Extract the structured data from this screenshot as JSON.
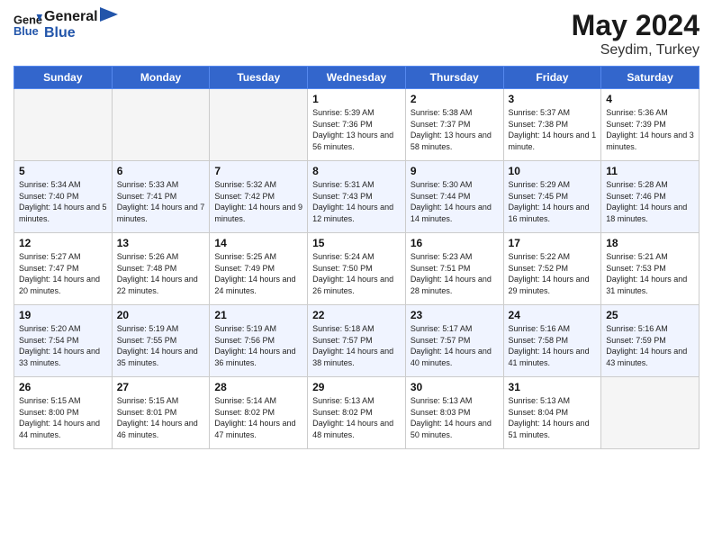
{
  "header": {
    "logo_line1": "General",
    "logo_line2": "Blue",
    "month_year": "May 2024",
    "location": "Seydim, Turkey"
  },
  "days_of_week": [
    "Sunday",
    "Monday",
    "Tuesday",
    "Wednesday",
    "Thursday",
    "Friday",
    "Saturday"
  ],
  "weeks": [
    [
      {
        "empty": true
      },
      {
        "empty": true
      },
      {
        "empty": true
      },
      {
        "day": "1",
        "sunrise": "5:39 AM",
        "sunset": "7:36 PM",
        "daylight": "13 hours and 56 minutes."
      },
      {
        "day": "2",
        "sunrise": "5:38 AM",
        "sunset": "7:37 PM",
        "daylight": "13 hours and 58 minutes."
      },
      {
        "day": "3",
        "sunrise": "5:37 AM",
        "sunset": "7:38 PM",
        "daylight": "14 hours and 1 minute."
      },
      {
        "day": "4",
        "sunrise": "5:36 AM",
        "sunset": "7:39 PM",
        "daylight": "14 hours and 3 minutes."
      }
    ],
    [
      {
        "day": "5",
        "sunrise": "5:34 AM",
        "sunset": "7:40 PM",
        "daylight": "14 hours and 5 minutes."
      },
      {
        "day": "6",
        "sunrise": "5:33 AM",
        "sunset": "7:41 PM",
        "daylight": "14 hours and 7 minutes."
      },
      {
        "day": "7",
        "sunrise": "5:32 AM",
        "sunset": "7:42 PM",
        "daylight": "14 hours and 9 minutes."
      },
      {
        "day": "8",
        "sunrise": "5:31 AM",
        "sunset": "7:43 PM",
        "daylight": "14 hours and 12 minutes."
      },
      {
        "day": "9",
        "sunrise": "5:30 AM",
        "sunset": "7:44 PM",
        "daylight": "14 hours and 14 minutes."
      },
      {
        "day": "10",
        "sunrise": "5:29 AM",
        "sunset": "7:45 PM",
        "daylight": "14 hours and 16 minutes."
      },
      {
        "day": "11",
        "sunrise": "5:28 AM",
        "sunset": "7:46 PM",
        "daylight": "14 hours and 18 minutes."
      }
    ],
    [
      {
        "day": "12",
        "sunrise": "5:27 AM",
        "sunset": "7:47 PM",
        "daylight": "14 hours and 20 minutes."
      },
      {
        "day": "13",
        "sunrise": "5:26 AM",
        "sunset": "7:48 PM",
        "daylight": "14 hours and 22 minutes."
      },
      {
        "day": "14",
        "sunrise": "5:25 AM",
        "sunset": "7:49 PM",
        "daylight": "14 hours and 24 minutes."
      },
      {
        "day": "15",
        "sunrise": "5:24 AM",
        "sunset": "7:50 PM",
        "daylight": "14 hours and 26 minutes."
      },
      {
        "day": "16",
        "sunrise": "5:23 AM",
        "sunset": "7:51 PM",
        "daylight": "14 hours and 28 minutes."
      },
      {
        "day": "17",
        "sunrise": "5:22 AM",
        "sunset": "7:52 PM",
        "daylight": "14 hours and 29 minutes."
      },
      {
        "day": "18",
        "sunrise": "5:21 AM",
        "sunset": "7:53 PM",
        "daylight": "14 hours and 31 minutes."
      }
    ],
    [
      {
        "day": "19",
        "sunrise": "5:20 AM",
        "sunset": "7:54 PM",
        "daylight": "14 hours and 33 minutes."
      },
      {
        "day": "20",
        "sunrise": "5:19 AM",
        "sunset": "7:55 PM",
        "daylight": "14 hours and 35 minutes."
      },
      {
        "day": "21",
        "sunrise": "5:19 AM",
        "sunset": "7:56 PM",
        "daylight": "14 hours and 36 minutes."
      },
      {
        "day": "22",
        "sunrise": "5:18 AM",
        "sunset": "7:57 PM",
        "daylight": "14 hours and 38 minutes."
      },
      {
        "day": "23",
        "sunrise": "5:17 AM",
        "sunset": "7:57 PM",
        "daylight": "14 hours and 40 minutes."
      },
      {
        "day": "24",
        "sunrise": "5:16 AM",
        "sunset": "7:58 PM",
        "daylight": "14 hours and 41 minutes."
      },
      {
        "day": "25",
        "sunrise": "5:16 AM",
        "sunset": "7:59 PM",
        "daylight": "14 hours and 43 minutes."
      }
    ],
    [
      {
        "day": "26",
        "sunrise": "5:15 AM",
        "sunset": "8:00 PM",
        "daylight": "14 hours and 44 minutes."
      },
      {
        "day": "27",
        "sunrise": "5:15 AM",
        "sunset": "8:01 PM",
        "daylight": "14 hours and 46 minutes."
      },
      {
        "day": "28",
        "sunrise": "5:14 AM",
        "sunset": "8:02 PM",
        "daylight": "14 hours and 47 minutes."
      },
      {
        "day": "29",
        "sunrise": "5:13 AM",
        "sunset": "8:02 PM",
        "daylight": "14 hours and 48 minutes."
      },
      {
        "day": "30",
        "sunrise": "5:13 AM",
        "sunset": "8:03 PM",
        "daylight": "14 hours and 50 minutes."
      },
      {
        "day": "31",
        "sunrise": "5:13 AM",
        "sunset": "8:04 PM",
        "daylight": "14 hours and 51 minutes."
      },
      {
        "empty": true
      }
    ]
  ],
  "labels": {
    "sunrise_prefix": "Sunrise:",
    "sunset_prefix": "Sunset:",
    "daylight_prefix": "Daylight:"
  }
}
